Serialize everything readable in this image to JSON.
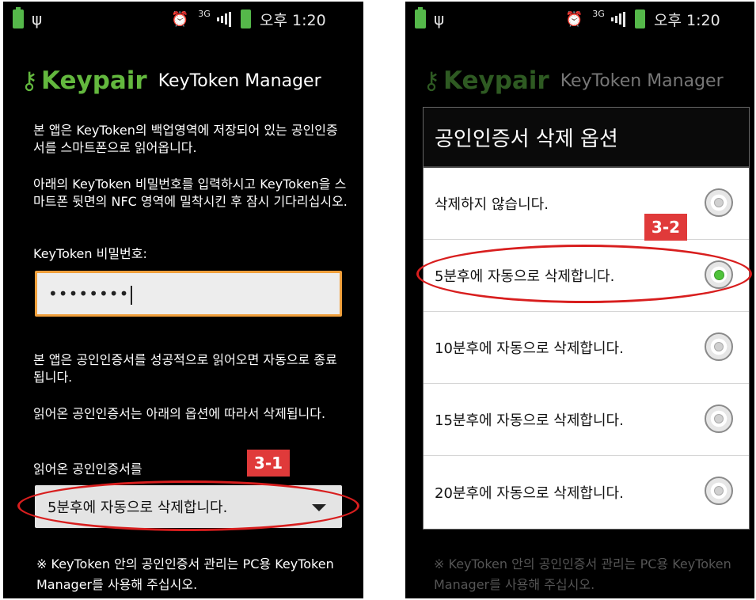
{
  "status_bar": {
    "usb_icon": "ψ",
    "network": "3G",
    "time": "오후 1:20"
  },
  "app": {
    "logo": "Keypair",
    "title": "KeyToken Manager"
  },
  "left_screen": {
    "intro": "본 앱은 KeyToken의 백업영역에 저장되어 있는 공인인증서를 스마트폰으로 읽어옵니다.",
    "instructions": "아래의 KeyToken 비밀번호를 입력하시고 KeyToken을 스마트폰 뒷면의 NFC 영역에 밀착시킨 후 잠시 기다리십시오.",
    "password_label": "KeyToken 비밀번호:",
    "password_value": "••••••••",
    "auto_close_note": "본 앱은 공인인증서를 성공적으로 읽어오면 자동으로 종료됩니다.",
    "delete_note": "읽어온 공인인증서는 아래의 옵션에 따라서 삭제됩니다.",
    "option_label": "읽어온 공인인증서를",
    "selected_option": "5분후에 자동으로 삭제합니다.",
    "badge": "3-1",
    "footer": "※ KeyToken 안의 공인인증서 관리는 PC용 KeyToken Manager를 사용해 주십시오."
  },
  "right_screen": {
    "dialog_title": "공인인증서 삭제 옵션",
    "options": [
      {
        "label": "삭제하지 않습니다.",
        "checked": false
      },
      {
        "label": "5분후에 자동으로 삭제합니다.",
        "checked": true
      },
      {
        "label": "10분후에 자동으로 삭제합니다.",
        "checked": false
      },
      {
        "label": "15분후에 자동으로 삭제합니다.",
        "checked": false
      },
      {
        "label": "20분후에 자동으로 삭제합니다.",
        "checked": false
      }
    ],
    "badge": "3-2",
    "footer": "※ KeyToken 안의 공인인증서 관리는 PC용 KeyToken Manager를 사용해 주십시오."
  },
  "colors": {
    "brand_green": "#63b83e",
    "input_focus": "#f0a03c",
    "annotation_red": "#d81e1e",
    "radio_checked": "#4fc23a"
  }
}
